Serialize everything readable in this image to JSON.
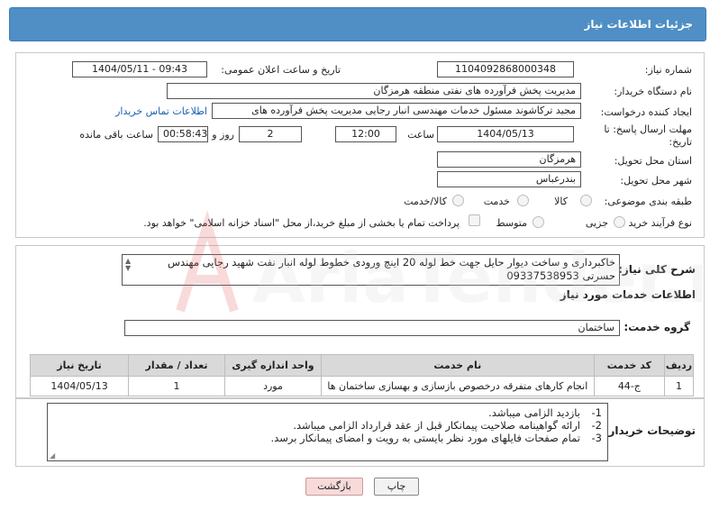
{
  "header": {
    "title": "جزئیات اطلاعات نیاز"
  },
  "fields": {
    "need_number_label": "شماره نیاز:",
    "need_number": "1104092868000348",
    "announce_label": "تاریخ و ساعت اعلان عمومی:",
    "announce_value": "1404/05/11 - 09:43",
    "buyer_org_label": "نام دستگاه خریدار:",
    "buyer_org": "مدیریت پخش فرآورده های نفتی منطقه هرمزگان",
    "creator_label": "ایجاد کننده درخواست:",
    "creator": "مجید ترکاشوند مسئول خدمات مهندسی انبار رجایی مدیریت پخش فرآورده های",
    "contact_link": "اطلاعات تماس خریدار",
    "deadline_label_1": "مهلت ارسال پاسخ: تا",
    "deadline_label_2": "تاریخ:",
    "deadline_date": "1404/05/13",
    "time_label": "ساعت",
    "deadline_time": "12:00",
    "days_value": "2",
    "days_label": "روز و",
    "remaining_time": "00:58:43",
    "remaining_label": "ساعت باقی مانده",
    "province_label": "استان محل تحویل:",
    "province": "هرمزگان",
    "city_label": "شهر محل تحویل:",
    "city": "بندرعباس",
    "category_label": "طبقه بندی موضوعی:",
    "category_options": [
      "کالا",
      "خدمت",
      "کالا/خدمت"
    ],
    "purchase_label": "نوع فرآیند خرید :",
    "purchase_options": [
      "جزیی",
      "متوسط"
    ],
    "payment_note": "پرداخت تمام یا بخشی از مبلغ خرید،از محل \"اسناد خزانه اسلامی\" خواهد بود."
  },
  "description": {
    "label": "شرح کلی نیاز:",
    "text": "خاکبرداری و ساخت دیوار حایل جهت خط لوله 20 اینچ ورودی خطوط لوله انبار نفت شهید رجایی مهندس حسرتی 09337538953"
  },
  "services": {
    "section_title": "اطلاعات خدمات مورد نیاز",
    "group_label": "گروه خدمت:",
    "group_value": "ساختمان",
    "table": {
      "headers": [
        "ردیف",
        "کد خدمت",
        "نام خدمت",
        "واحد اندازه گیری",
        "تعداد / مقدار",
        "تاریخ نیاز"
      ],
      "rows": [
        [
          "1",
          "ج-44",
          "انجام کارهای متفرقه درخصوص بازسازی و بهسازی ساختمان ها",
          "مورد",
          "1",
          "1404/05/13"
        ]
      ]
    }
  },
  "buyer_notes": {
    "label": "توضیحات خریدار:",
    "lines": [
      {
        "num": "1-",
        "text": "بازدید الزامی میباشد."
      },
      {
        "num": "2-",
        "text": "ارائه گواهینامه صلاحیت پیمانکار قبل از عقد قرارداد الزامی میباشد."
      },
      {
        "num": "3-",
        "text": "تمام صفحات فایلهای مورد نظر بایستی به رویت و امضای پیمانکار برسد."
      }
    ]
  },
  "buttons": {
    "print": "چاپ",
    "back": "بازگشت"
  },
  "watermark": {
    "text": "AriaTender.net"
  }
}
